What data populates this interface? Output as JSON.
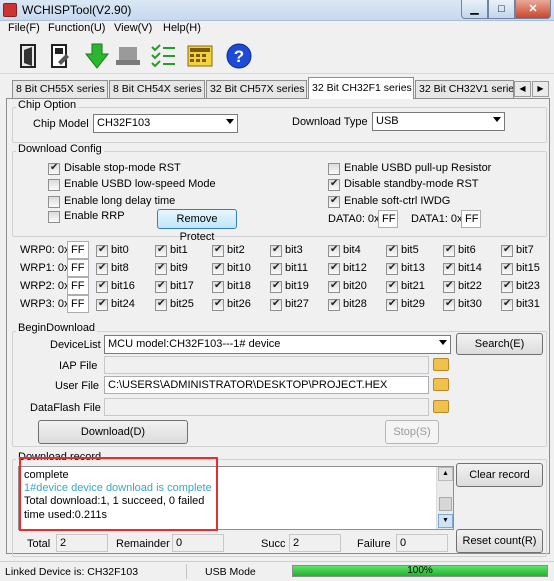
{
  "window": {
    "title": "WCHISPTool(V2.90)"
  },
  "menu": [
    "File(F)",
    "Function(U)",
    "View(V)",
    "Help(H)"
  ],
  "toolbar": {
    "icons": [
      "open-config-icon",
      "save-config-icon",
      "download-arrow-icon",
      "device-icon",
      "batch-list-icon",
      "calculator-icon",
      "help-icon"
    ],
    "help_glyph": "?"
  },
  "tabs": [
    "8 Bit CH55X series",
    "8 Bit CH54X series",
    "32 Bit CH57X series",
    "32 Bit CH32F1 series",
    "32 Bit CH32V1 serie"
  ],
  "chip_option": {
    "label": "Chip Option",
    "model_label": "Chip Model",
    "model_value": "CH32F103",
    "download_type_label": "Download Type",
    "download_type_value": "USB"
  },
  "download_config": {
    "label": "Download Config",
    "options_left": [
      {
        "label": "Disable stop-mode RST",
        "checked": true
      },
      {
        "label": "Enable USBD low-speed Mode",
        "checked": false
      },
      {
        "label": "Enable long delay time",
        "checked": false
      },
      {
        "label": "Enable RRP",
        "checked": false
      }
    ],
    "options_right": [
      {
        "label": "Enable USBD pull-up Resistor",
        "checked": false
      },
      {
        "label": "Disable standby-mode RST",
        "checked": true
      },
      {
        "label": "Enable soft-ctrl IWDG",
        "checked": true
      }
    ],
    "remove_protect": "Remove Protect",
    "data0_label": "DATA0: 0x",
    "data0_value": "FF",
    "data1_label": "DATA1: 0x",
    "data1_value": "FF"
  },
  "wrp": [
    {
      "label": "WRP0: 0x",
      "value": "FF",
      "bits": [
        "bit0",
        "bit1",
        "bit2",
        "bit3",
        "bit4",
        "bit5",
        "bit6",
        "bit7"
      ]
    },
    {
      "label": "WRP1: 0x",
      "value": "FF",
      "bits": [
        "bit8",
        "bit9",
        "bit10",
        "bit11",
        "bit12",
        "bit13",
        "bit14",
        "bit15"
      ]
    },
    {
      "label": "WRP2: 0x",
      "value": "FF",
      "bits": [
        "bit16",
        "bit17",
        "bit18",
        "bit19",
        "bit20",
        "bit21",
        "bit22",
        "bit23"
      ]
    },
    {
      "label": "WRP3: 0x",
      "value": "FF",
      "bits": [
        "bit24",
        "bit25",
        "bit26",
        "bit27",
        "bit28",
        "bit29",
        "bit30",
        "bit31"
      ]
    }
  ],
  "begin_download": {
    "label": "BeginDownload",
    "device_list_label": "DeviceList",
    "device_list_value": "MCU model:CH32F103---1# device",
    "search_button": "Search(E)",
    "iap_label": "IAP File",
    "iap_value": "",
    "user_file_label": "User File",
    "user_file_value": "C:\\USERS\\ADMINISTRATOR\\DESKTOP\\PROJECT.HEX",
    "dataflash_label": "DataFlash File",
    "dataflash_value": "",
    "download_button": "Download(D)",
    "stop_button": "Stop(S)"
  },
  "download_record": {
    "label": "Download record",
    "lines": [
      {
        "text": "complete",
        "color": "#000000"
      },
      {
        "text": "1#device device download is complete",
        "color": "#3aa6c8"
      },
      {
        "text": "Total download:1, 1 succeed, 0 failed",
        "color": "#000000"
      },
      {
        "text": "time used:0.211s",
        "color": "#000000"
      }
    ],
    "clear_button": "Clear record",
    "highlight_color": "#e03030"
  },
  "counters": {
    "total_label": "Total",
    "total_value": "2",
    "remainder_label": "Remainder",
    "remainder_value": "0",
    "succ_label": "Succ",
    "succ_value": "2",
    "failure_label": "Failure",
    "failure_value": "0",
    "reset_button": "Reset count(R)"
  },
  "status": {
    "linked_device": "Linked Device is: CH32F103",
    "mode": "USB Mode",
    "progress_text": "100%",
    "progress_fraction": 1.0,
    "progress_color": "#1eb42a"
  }
}
